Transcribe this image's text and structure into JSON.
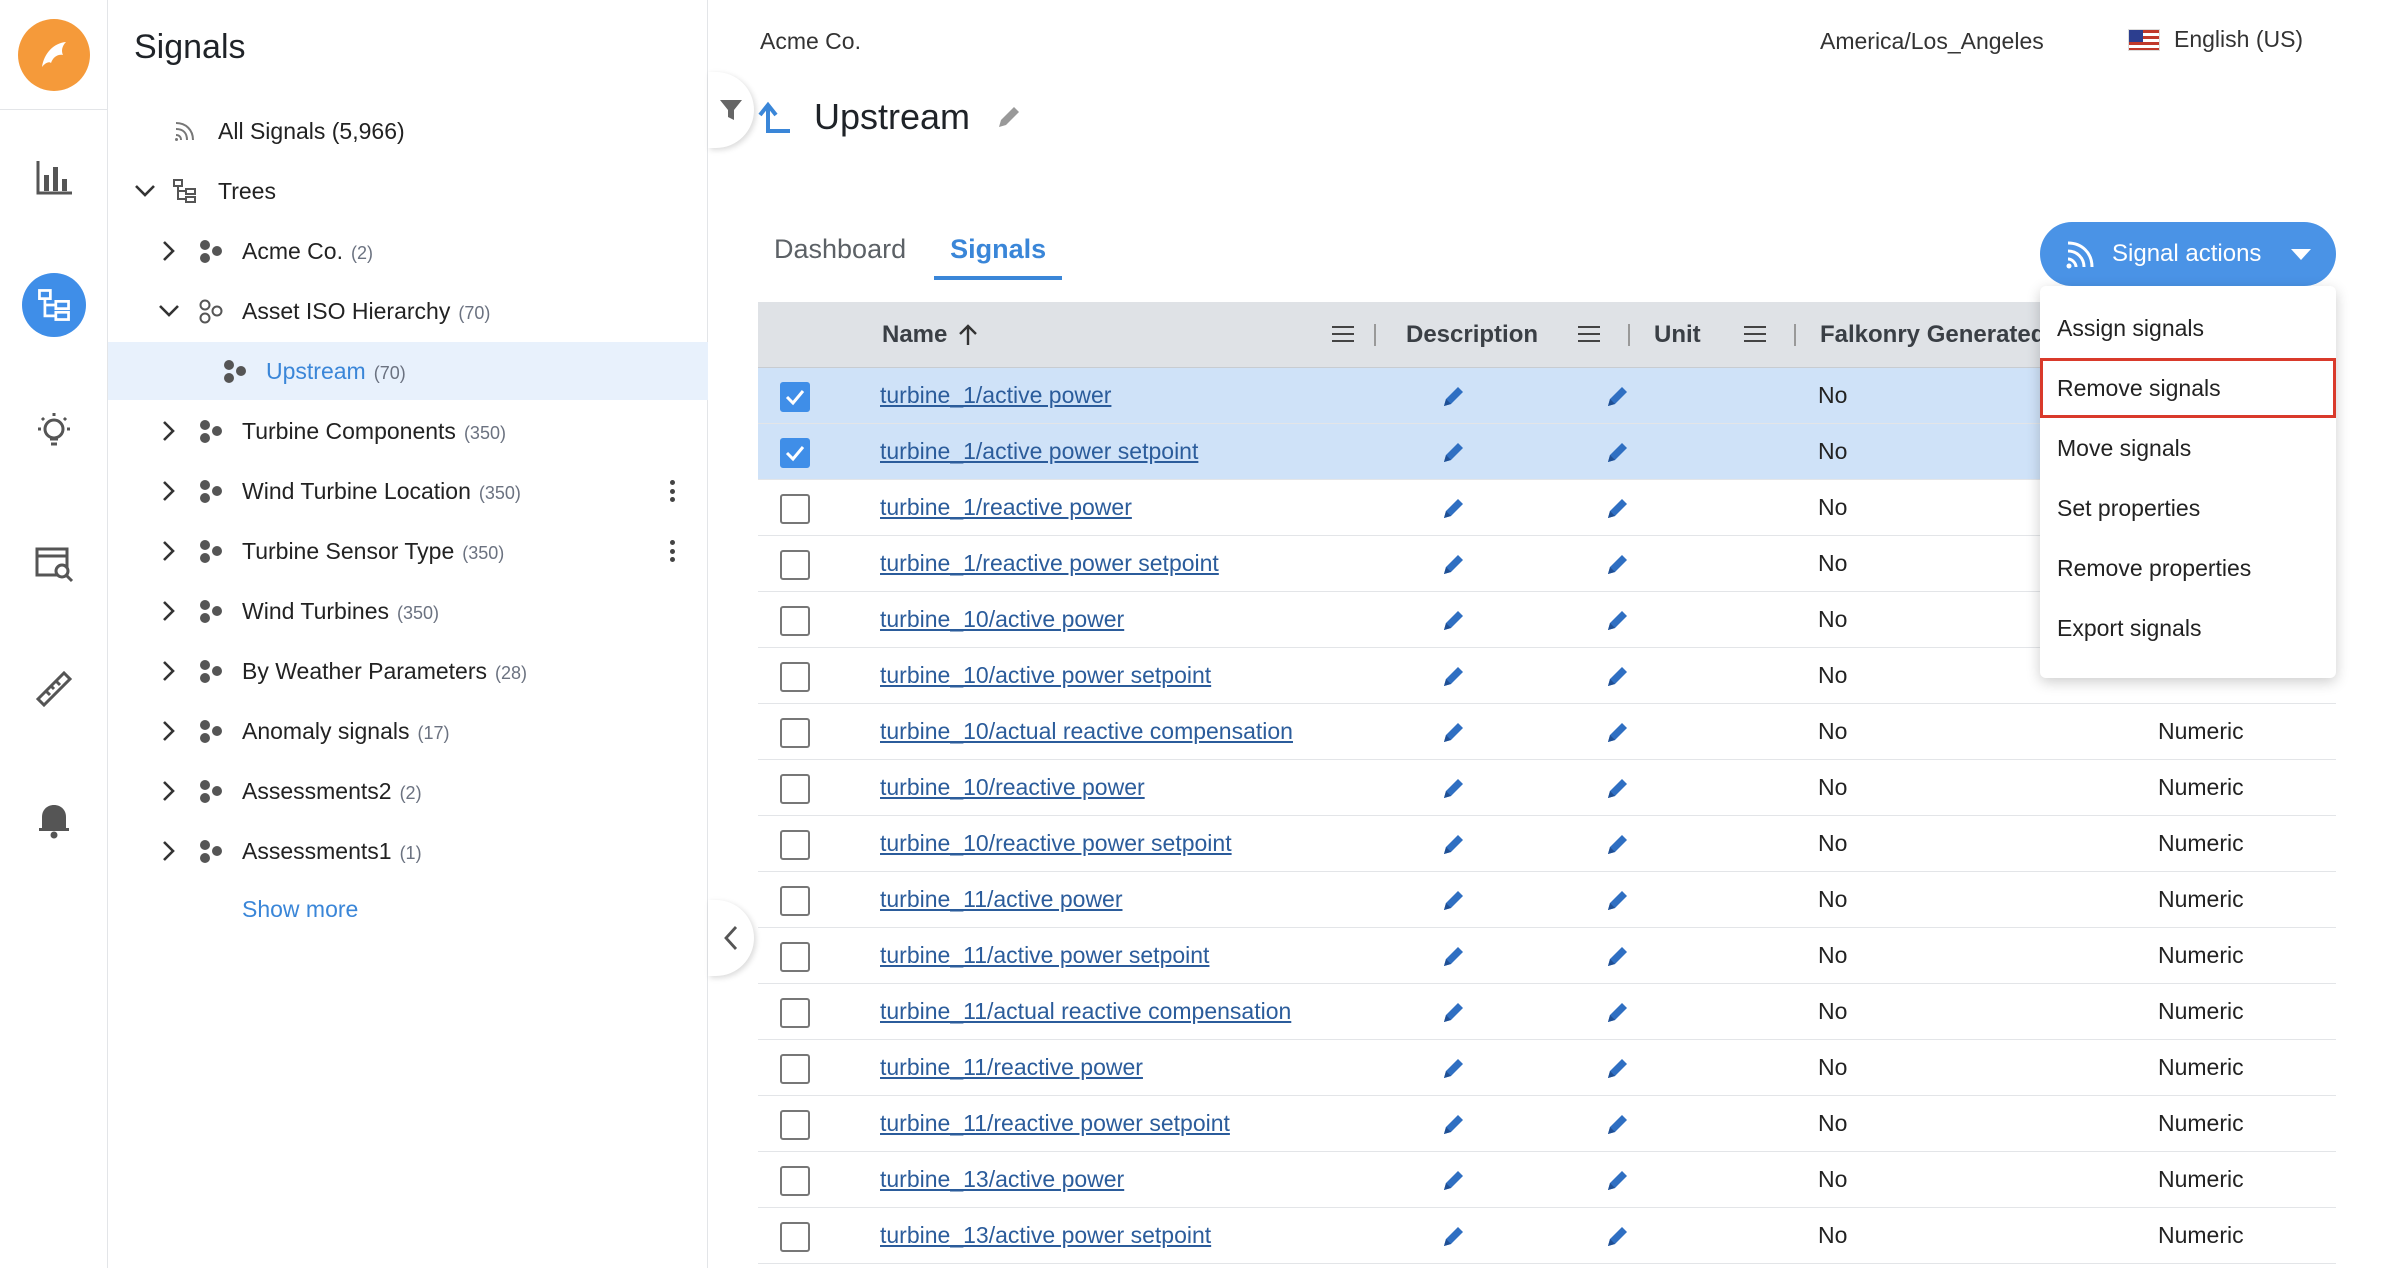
{
  "sidebar_title": "Signals",
  "tree": {
    "all_signals": "All Signals (5,966)",
    "trees_label": "Trees",
    "nodes": [
      {
        "label": "Acme Co.",
        "count": "(2)"
      },
      {
        "label": "Asset ISO Hierarchy",
        "count": "(70)"
      },
      {
        "label": "Upstream",
        "count": "(70)"
      },
      {
        "label": "Turbine Components",
        "count": "(350)"
      },
      {
        "label": "Wind Turbine Location",
        "count": "(350)"
      },
      {
        "label": "Turbine Sensor Type",
        "count": "(350)"
      },
      {
        "label": "Wind Turbines",
        "count": "(350)"
      },
      {
        "label": "By Weather Parameters",
        "count": "(28)"
      },
      {
        "label": "Anomaly signals",
        "count": "(17)"
      },
      {
        "label": "Assessments2",
        "count": "(2)"
      },
      {
        "label": "Assessments1",
        "count": "(1)"
      }
    ],
    "show_more": "Show more"
  },
  "topbar": {
    "company": "Acme Co.",
    "timezone": "America/Los_Angeles",
    "language": "English (US)"
  },
  "page_title": "Upstream",
  "tabs": [
    "Dashboard",
    "Signals"
  ],
  "signal_actions_label": "Signal actions",
  "menu": [
    "Assign signals",
    "Remove signals",
    "Move signals",
    "Set properties",
    "Remove properties",
    "Export signals"
  ],
  "table": {
    "headers": {
      "name": "Name",
      "description": "Description",
      "unit": "Unit",
      "falkonry": "Falkonry Generated"
    },
    "rows": [
      {
        "name": "turbine_1/active power",
        "fk": "No",
        "type": "",
        "checked": true
      },
      {
        "name": "turbine_1/active power setpoint",
        "fk": "No",
        "type": "",
        "checked": true
      },
      {
        "name": "turbine_1/reactive power",
        "fk": "No",
        "type": "",
        "checked": false
      },
      {
        "name": "turbine_1/reactive power setpoint",
        "fk": "No",
        "type": "",
        "checked": false
      },
      {
        "name": "turbine_10/active power",
        "fk": "No",
        "type": "",
        "checked": false
      },
      {
        "name": "turbine_10/active power setpoint",
        "fk": "No",
        "type": "",
        "checked": false
      },
      {
        "name": "turbine_10/actual reactive compensation",
        "fk": "No",
        "type": "Numeric",
        "checked": false
      },
      {
        "name": "turbine_10/reactive power",
        "fk": "No",
        "type": "Numeric",
        "checked": false
      },
      {
        "name": "turbine_10/reactive power setpoint",
        "fk": "No",
        "type": "Numeric",
        "checked": false
      },
      {
        "name": "turbine_11/active power",
        "fk": "No",
        "type": "Numeric",
        "checked": false
      },
      {
        "name": "turbine_11/active power setpoint",
        "fk": "No",
        "type": "Numeric",
        "checked": false
      },
      {
        "name": "turbine_11/actual reactive compensation",
        "fk": "No",
        "type": "Numeric",
        "checked": false
      },
      {
        "name": "turbine_11/reactive power",
        "fk": "No",
        "type": "Numeric",
        "checked": false
      },
      {
        "name": "turbine_11/reactive power setpoint",
        "fk": "No",
        "type": "Numeric",
        "checked": false
      },
      {
        "name": "turbine_13/active power",
        "fk": "No",
        "type": "Numeric",
        "checked": false
      },
      {
        "name": "turbine_13/active power setpoint",
        "fk": "No",
        "type": "Numeric",
        "checked": false
      }
    ]
  },
  "colors": {
    "accent": "#3a86d8",
    "highlight_border": "#d93a2b",
    "selected_row": "#cfe2f8",
    "logo": "#f59a3a"
  }
}
